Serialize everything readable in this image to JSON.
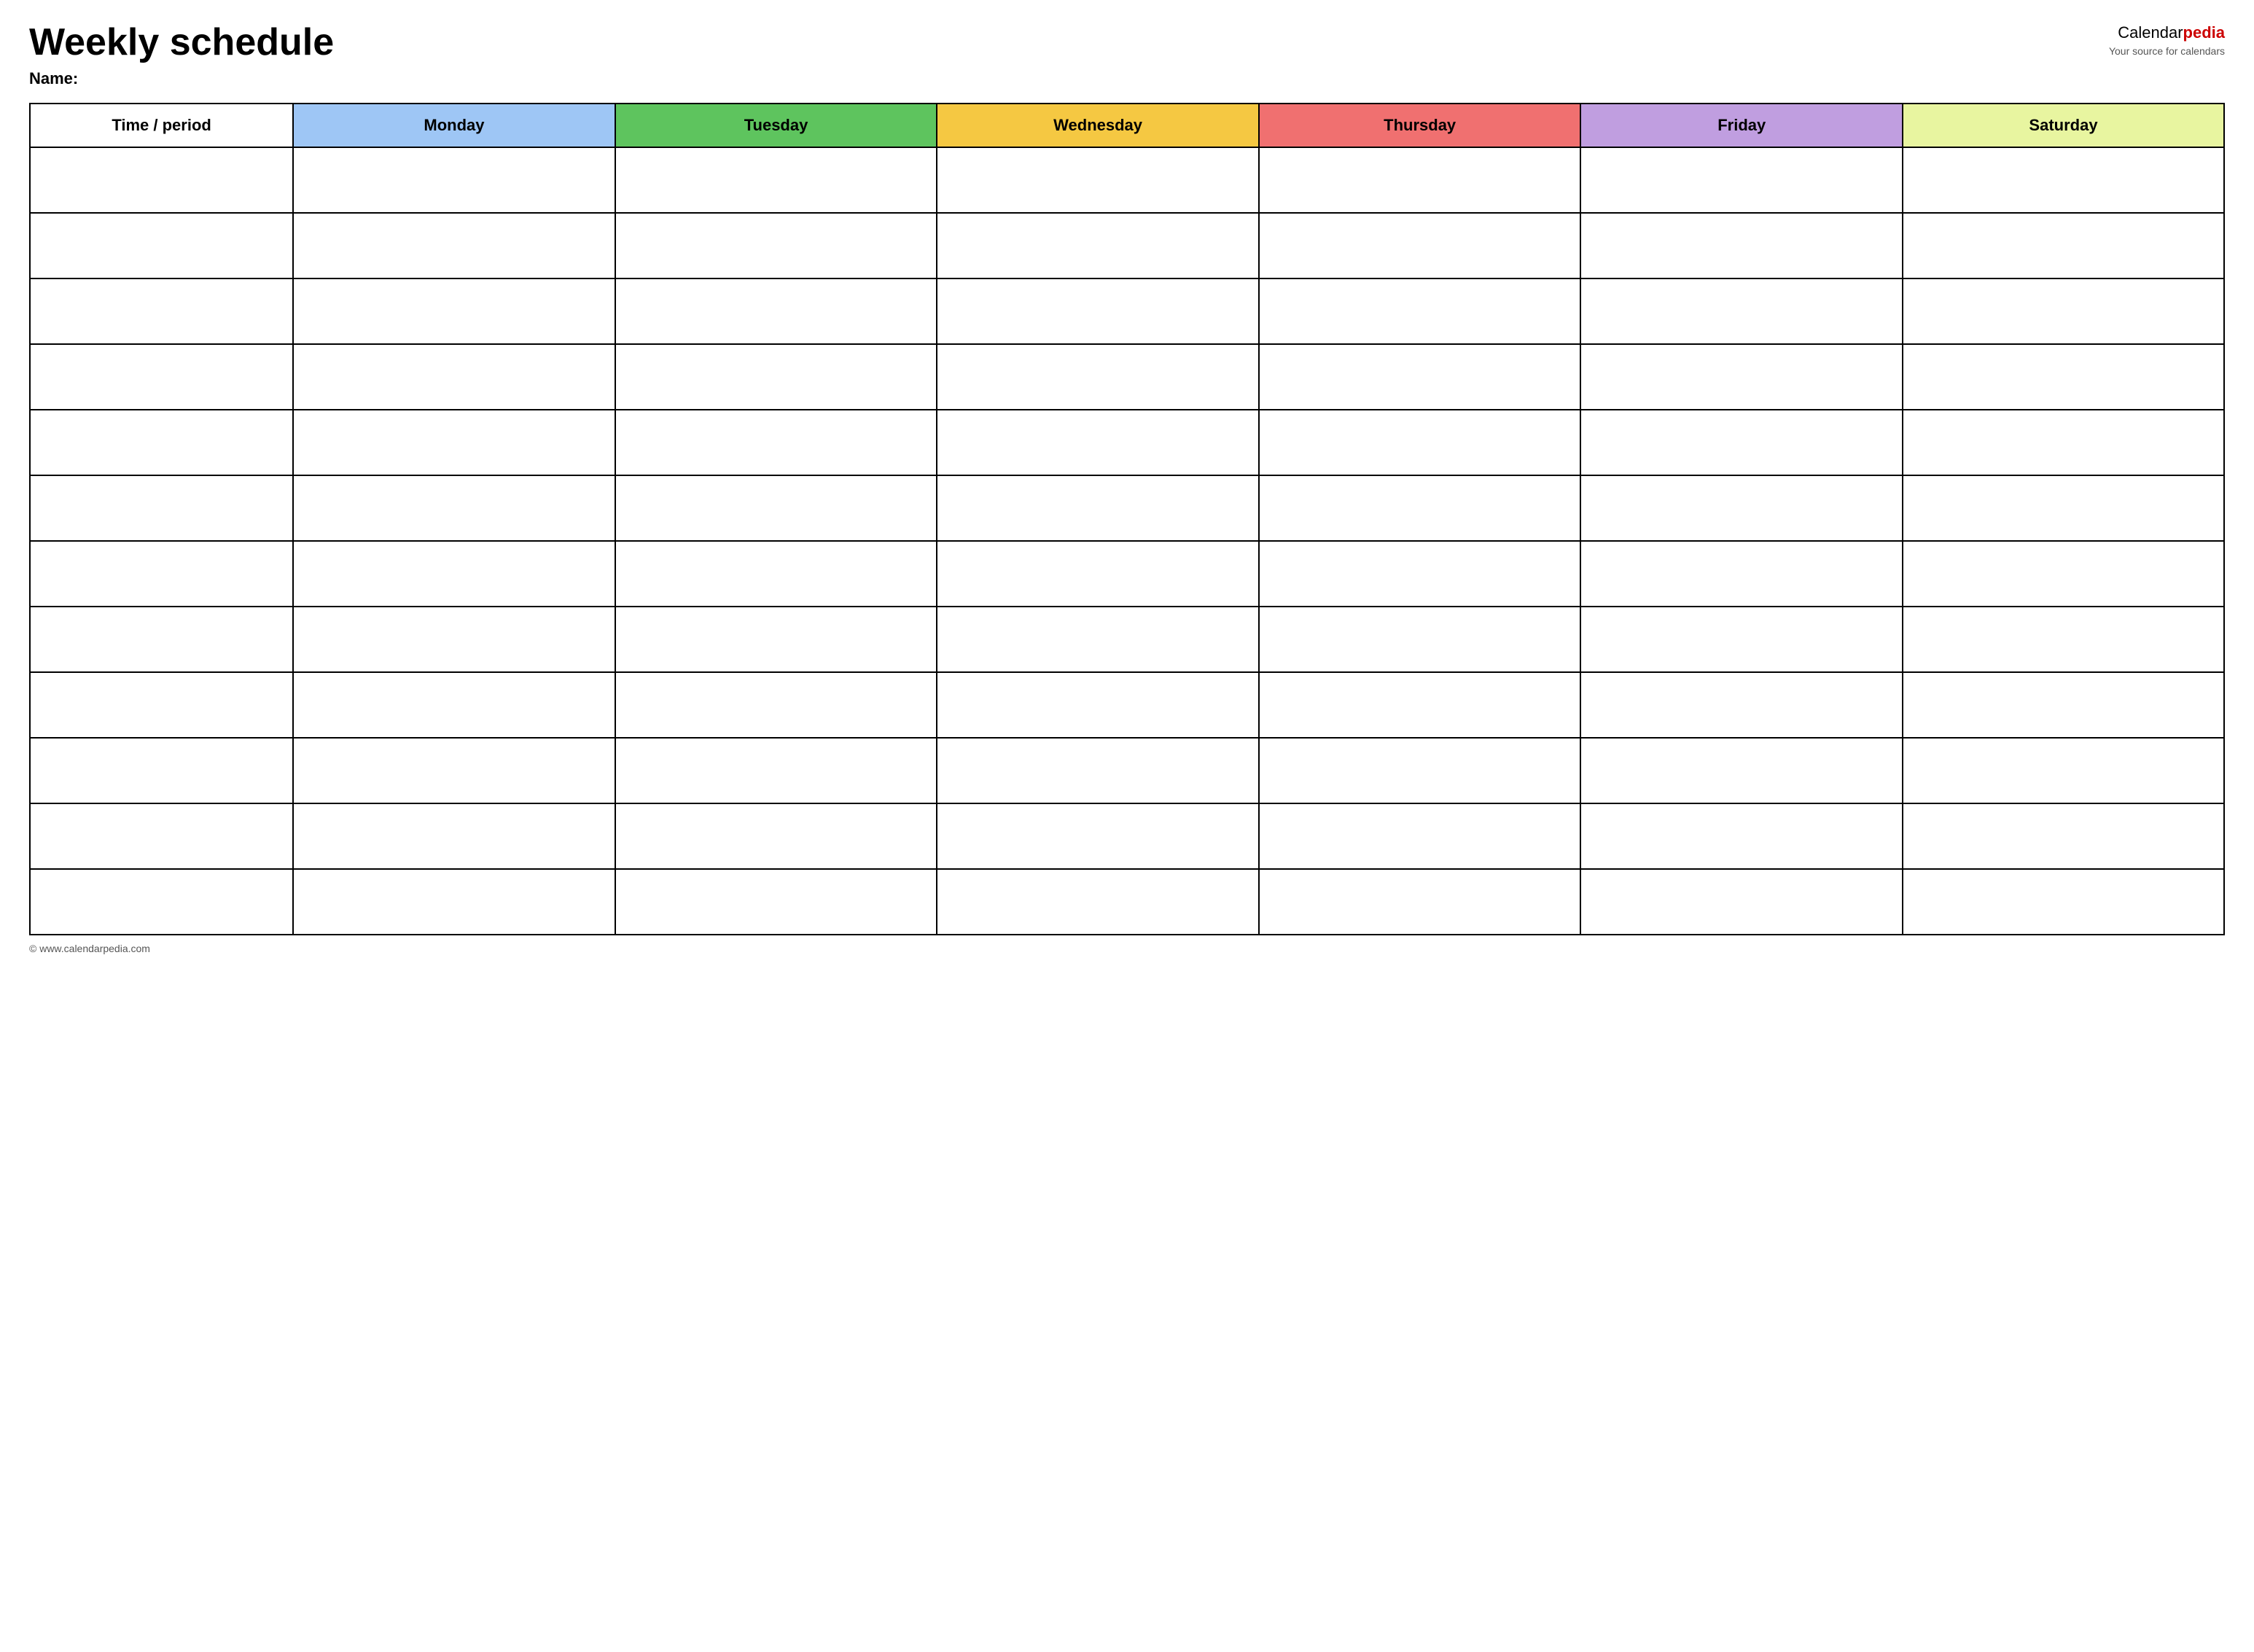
{
  "header": {
    "main_title": "Weekly schedule",
    "name_label": "Name:",
    "logo_text_calendar": "Calendar",
    "logo_text_pedia": "pedia",
    "logo_tagline": "Your source for calendars"
  },
  "table": {
    "columns": [
      {
        "id": "time",
        "label": "Time / period",
        "color": "#ffffff"
      },
      {
        "id": "monday",
        "label": "Monday",
        "color": "#9ec6f5"
      },
      {
        "id": "tuesday",
        "label": "Tuesday",
        "color": "#5ec45e"
      },
      {
        "id": "wednesday",
        "label": "Wednesday",
        "color": "#f5c842"
      },
      {
        "id": "thursday",
        "label": "Thursday",
        "color": "#f07070"
      },
      {
        "id": "friday",
        "label": "Friday",
        "color": "#c09ee0"
      },
      {
        "id": "saturday",
        "label": "Saturday",
        "color": "#e8f5a0"
      }
    ],
    "row_count": 12
  },
  "footer": {
    "url": "© www.calendarpedia.com"
  }
}
